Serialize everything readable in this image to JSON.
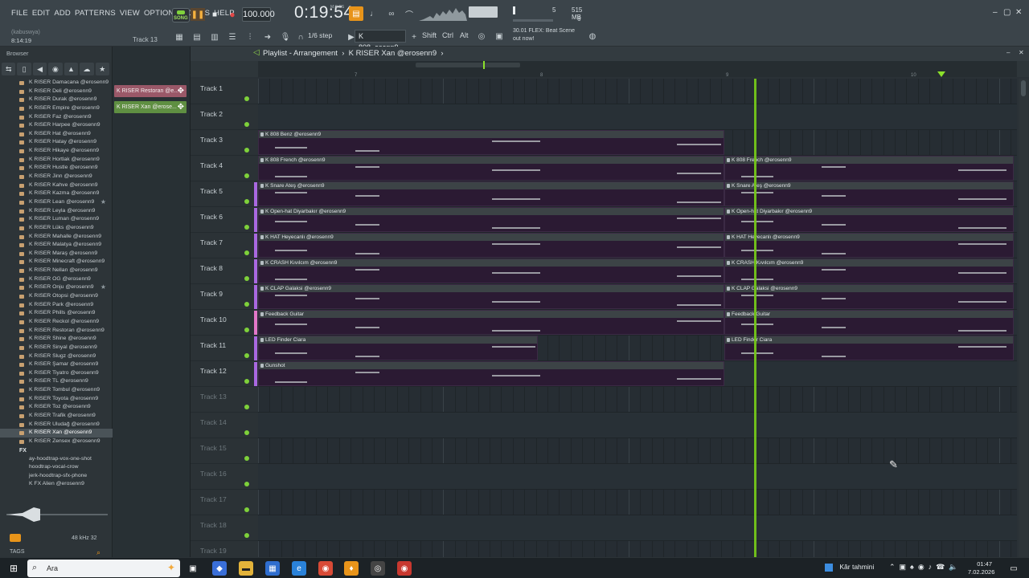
{
  "menu": [
    "FILE",
    "EDIT",
    "ADD",
    "PATTERNS",
    "VIEW",
    "OPTIONS",
    "TOOLS",
    "HELP"
  ],
  "song_mode": "SONG",
  "tempo": "100.000",
  "time": "0:19:54",
  "time_unit": "M:S:CS",
  "memory": {
    "cpu": "5",
    "ram": "515 MB",
    "poly": "6"
  },
  "hint": {
    "line1": "30.01  FLEX: Beat Scene",
    "line2": "out now!"
  },
  "user": "(kabuswya)",
  "elapsed": "8:14:19",
  "current_track": "Track 13",
  "snap": "1/6 step",
  "pattern": "K 808..osenn9",
  "keys": [
    "Shift",
    "Ctrl",
    "Alt"
  ],
  "browser": {
    "title": "Browser",
    "files": [
      "K RISER Damacana @erosenn9",
      "K RISER Deli @erosenn9",
      "K RISER Durak @erosenn9",
      "K RISER Empire @erosenn9",
      "K RISER Faz @erosenn9",
      "K RISER Harpee @erosenn9",
      "K RISER Hat @erosenn9",
      "K RISER Hatay @erosenn9",
      "K RISER Hikaye @erosenn9",
      "K RISER Hortlak @erosenn9",
      "K RISER Hustle @erosenn9",
      "K RISER Jinn @erosenn9",
      "K RISER Kahve @erosenn9",
      "K RISER Kazma @erosenn9",
      "K RISER Lean @erosenn9",
      "K RISER Leyla @erosenn9",
      "K RISER Luman @erosenn9",
      "K RISER Lüks @erosenn9",
      "K RISER Mahalle @erosenn9",
      "K RISER Malatya @erosenn9",
      "K RISER Maraş @erosenn9",
      "K RISER Minecraft @erosenn9",
      "K RISER Nellan @erosenn9",
      "K RISER OG @erosenn9",
      "K RISER Onju @erosenn9",
      "K RISER Otopsi @erosenn9",
      "K RISER Park @erosenn9",
      "K RISER Phills @erosenn9",
      "K RISER Reckol @erosenn9",
      "K RISER Restoran @erosenn9",
      "K RISER Shine @erosenn9",
      "K RISER Sinyal @erosenn9",
      "K RISER Slugz @erosenn9",
      "K RISER Şamar @erosenn9",
      "K RISER Tiyatro @erosenn9",
      "K RISER TL @erosenn9",
      "K RISER Tombul @erosenn9",
      "K RISER Toyota @erosenn9",
      "K RISER Toz @erosenn9",
      "K RISER Trafik @erosenn9",
      "K RISER Uludağ @erosenn9",
      "K RISER Xan @erosenn9",
      "K RISER Zensex @erosenn9"
    ],
    "starred": [
      14,
      24
    ],
    "selected": 41,
    "fx_folder": "FX",
    "extra_files": [
      "ay-hoodtrap-vox-one-shot",
      "hoodtrap-vocal-crow",
      "jerk-hoodtrap-sfx-phone",
      "K FX Alien @erosenn9"
    ],
    "sample_rate": "48 kHz 32",
    "tags": "TAGS"
  },
  "picker": [
    {
      "label": "K RISER Restoran @e...",
      "color": "#a45b6e"
    },
    {
      "label": "K RISER Xan @erose...",
      "color": "#6b9a4a"
    }
  ],
  "playlist": {
    "title": "Playlist - Arrangement",
    "pattern": "K RISER Xan @erosenn9",
    "bar_marks": [
      "7",
      "8",
      "9",
      "10"
    ],
    "tracks": [
      "Track 1",
      "Track 2",
      "Track 3",
      "Track 4",
      "Track 5",
      "Track 6",
      "Track 7",
      "Track 8",
      "Track 9",
      "Track 10",
      "Track 11",
      "Track 12",
      "Track 13",
      "Track 14",
      "Track 15",
      "Track 16",
      "Track 17",
      "Track 18",
      "Track 19"
    ],
    "clip_names": [
      "K 808 Benz @erosenn9",
      "K 808 French @erosenn9",
      "K Snare Ateş @erosenn9",
      "K Open-hat Diyarbakır @erosenn9",
      "K HAT Heyecanlı @erosenn9",
      "K CRASH Kıvılcım @erosenn9",
      "K CLAP Galaksi @erosenn9",
      "Feedback Guitar",
      "LED Finder Ciara",
      "Gunshot"
    ]
  },
  "taskbar": {
    "search_placeholder": "Ara",
    "weather": "Kâr tahmini",
    "time": "01:47",
    "date": "7.02.2026"
  }
}
